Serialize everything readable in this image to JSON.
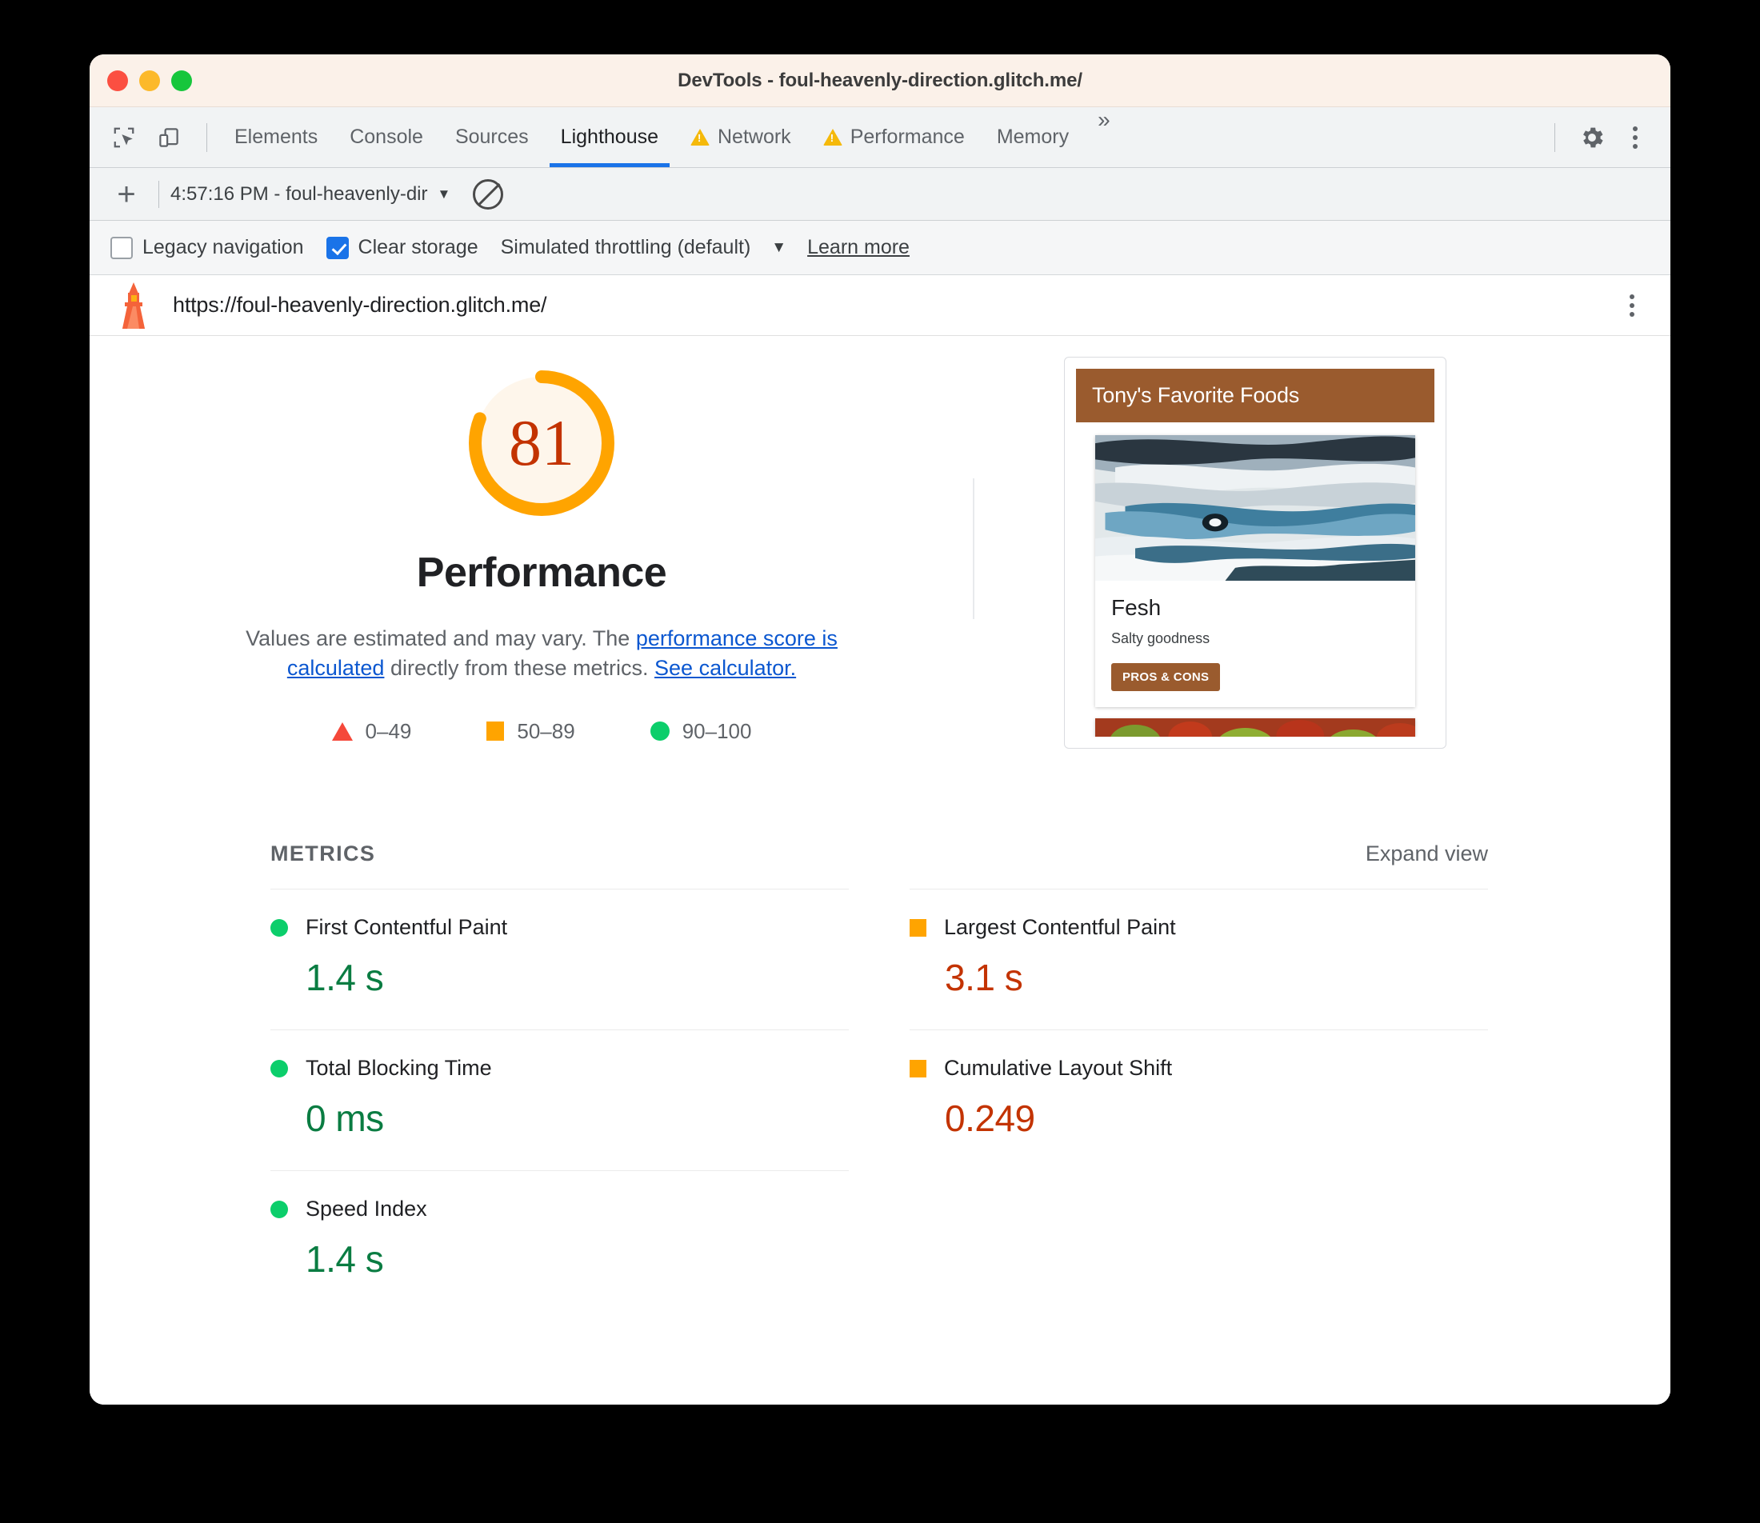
{
  "window": {
    "title": "DevTools - foul-heavenly-direction.glitch.me/",
    "traffic_lights": [
      "close-red",
      "minimize-yellow",
      "maximize-green"
    ]
  },
  "tabbar": {
    "icons": [
      "inspect-element-icon",
      "device-toolbar-icon"
    ],
    "tabs": [
      {
        "label": "Elements",
        "warning": false,
        "active": false
      },
      {
        "label": "Console",
        "warning": false,
        "active": false
      },
      {
        "label": "Sources",
        "warning": false,
        "active": false
      },
      {
        "label": "Lighthouse",
        "warning": false,
        "active": true
      },
      {
        "label": "Network",
        "warning": true,
        "active": false
      },
      {
        "label": "Performance",
        "warning": true,
        "active": false
      },
      {
        "label": "Memory",
        "warning": false,
        "active": false
      }
    ],
    "more_tabs": "»",
    "settings_icon": "gear-icon",
    "menu_icon": "kebab-menu-icon"
  },
  "runbar": {
    "new_report": "+",
    "selected_report": "4:57:16 PM - foul-heavenly-dir",
    "caret": "▼",
    "clear_icon": "no-entry-clear-icon"
  },
  "options": {
    "legacy_navigation": {
      "label": "Legacy navigation",
      "checked": false
    },
    "clear_storage": {
      "label": "Clear storage",
      "checked": true
    },
    "throttling": {
      "label": "Simulated throttling (default)",
      "caret": "▼"
    },
    "learn_more": "Learn more"
  },
  "urlbar": {
    "icon": "lighthouse-icon",
    "url": "https://foul-heavenly-direction.glitch.me/",
    "menu_icon": "kebab-menu-icon"
  },
  "category": {
    "score": "81",
    "score_percent": 81,
    "title": "Performance",
    "description_part1": "Values are estimated and may vary. The ",
    "link1": "performance score is calculated",
    "description_part2": " directly from these metrics. ",
    "link2": "See calculator.",
    "legend": [
      {
        "shape": "triangle",
        "range": "0–49",
        "color": "#f5483a"
      },
      {
        "shape": "square",
        "range": "50–89",
        "color": "#ffa400"
      },
      {
        "shape": "circle",
        "range": "90–100",
        "color": "#0cce6b"
      }
    ]
  },
  "thumbnail": {
    "header": "Tony's Favorite Foods",
    "card_title": "Fesh",
    "card_subtitle": "Salty goodness",
    "card_button": "PROS & CONS",
    "photo_alt": "fish-photo",
    "second_photo_alt": "vegetables-photo"
  },
  "metrics": {
    "section_label": "METRICS",
    "expand_view": "Expand view",
    "items": [
      {
        "name": "First Contentful Paint",
        "value": "1.4 s",
        "status": "pass",
        "shape": "circle",
        "color": "#0cce6b",
        "value_color": "#0a7c42"
      },
      {
        "name": "Largest Contentful Paint",
        "value": "3.1 s",
        "status": "average",
        "shape": "square",
        "color": "#ffa400",
        "value_color": "#c33300"
      },
      {
        "name": "Total Blocking Time",
        "value": "0 ms",
        "status": "pass",
        "shape": "circle",
        "color": "#0cce6b",
        "value_color": "#0a7c42"
      },
      {
        "name": "Cumulative Layout Shift",
        "value": "0.249",
        "status": "average",
        "shape": "square",
        "color": "#ffa400",
        "value_color": "#c33300"
      },
      {
        "name": "Speed Index",
        "value": "1.4 s",
        "status": "pass",
        "shape": "circle",
        "color": "#0cce6b",
        "value_color": "#0a7c42"
      }
    ]
  },
  "colors": {
    "accent_blue": "#1a73e8",
    "gauge_orange": "#ffa400",
    "gauge_bg": "#fef6eb",
    "score_text": "#c33300",
    "pass_green": "#0cce6b",
    "fail_red": "#f5483a",
    "brand_brown": "#9a5b2e"
  }
}
